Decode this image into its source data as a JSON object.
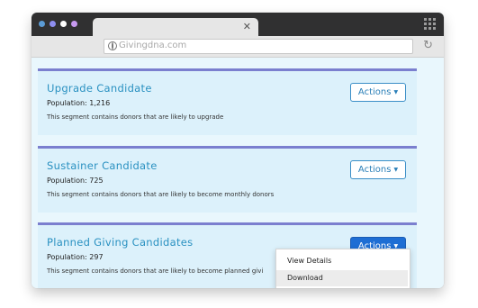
{
  "browser": {
    "url": "Givingdna.com",
    "tab_close_icon": "close-icon",
    "reload_icon": "reload-icon",
    "traffic_lights": [
      "#5b9bd5",
      "#8e8ef0",
      "#ffffff",
      "#c79af0"
    ]
  },
  "segments": [
    {
      "title": "Upgrade Candidate",
      "population": "Population: 1,216",
      "description": "This segment contains donors that are likely to upgrade",
      "actions_label": "Actions"
    },
    {
      "title": "Sustainer Candidate",
      "population": "Population: 725",
      "description": "This segment contains donors that are likely to become monthly donors",
      "actions_label": "Actions"
    },
    {
      "title": "Planned Giving Candidates",
      "population": "Population: 297",
      "description": "This segment contains donors that are likely to become planned givi",
      "actions_label": "Actions"
    }
  ],
  "dropdown": {
    "items": [
      "View Details",
      "Download"
    ]
  },
  "colors": {
    "accent": "#2a91c1",
    "card_border": "#7b7fcf",
    "active_button": "#1e6ed4"
  }
}
